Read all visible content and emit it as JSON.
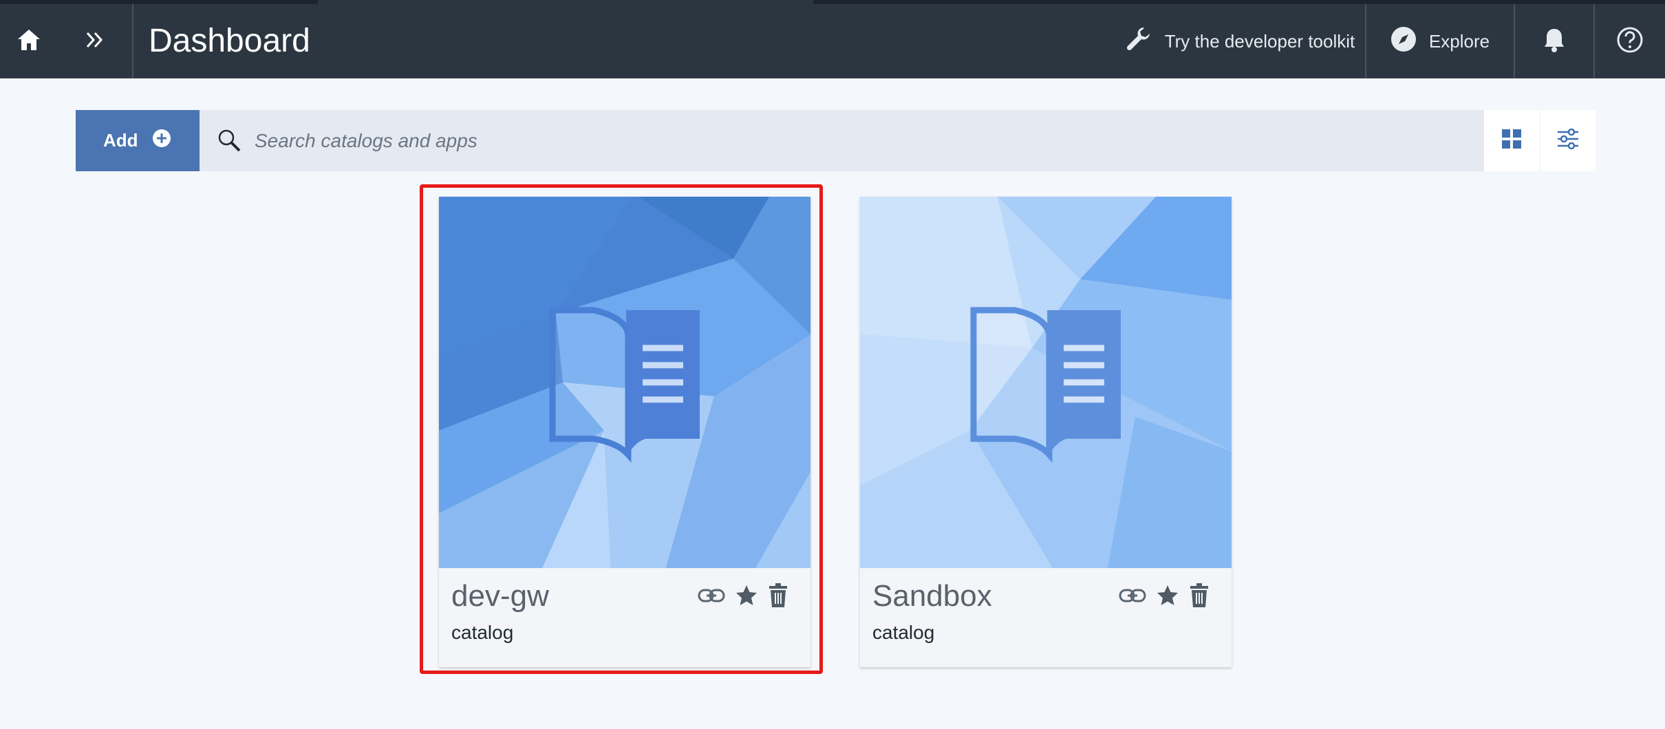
{
  "header": {
    "title": "Dashboard",
    "toolkit_label": "Try the developer toolkit",
    "explore_label": "Explore",
    "icons": [
      "home-icon",
      "chevron-double-right-icon",
      "wrench-icon",
      "compass-icon",
      "bell-icon",
      "help-icon"
    ]
  },
  "toolbar": {
    "add_label": "Add",
    "search_placeholder": "Search catalogs and apps",
    "view_icons": [
      "grid-view-icon",
      "filter-sliders-icon"
    ]
  },
  "cards": [
    {
      "name": "dev-gw",
      "type": "catalog",
      "selected": true
    },
    {
      "name": "Sandbox",
      "type": "catalog",
      "selected": false
    }
  ],
  "card_actions": [
    "link-icon",
    "star-icon",
    "trash-icon"
  ],
  "colors": {
    "header_bg": "#2b3640",
    "page_bg": "#f4f7fb",
    "add_button": "#4a74b2",
    "search_bg": "#e4e9f2",
    "highlight": "#e51a1a"
  }
}
